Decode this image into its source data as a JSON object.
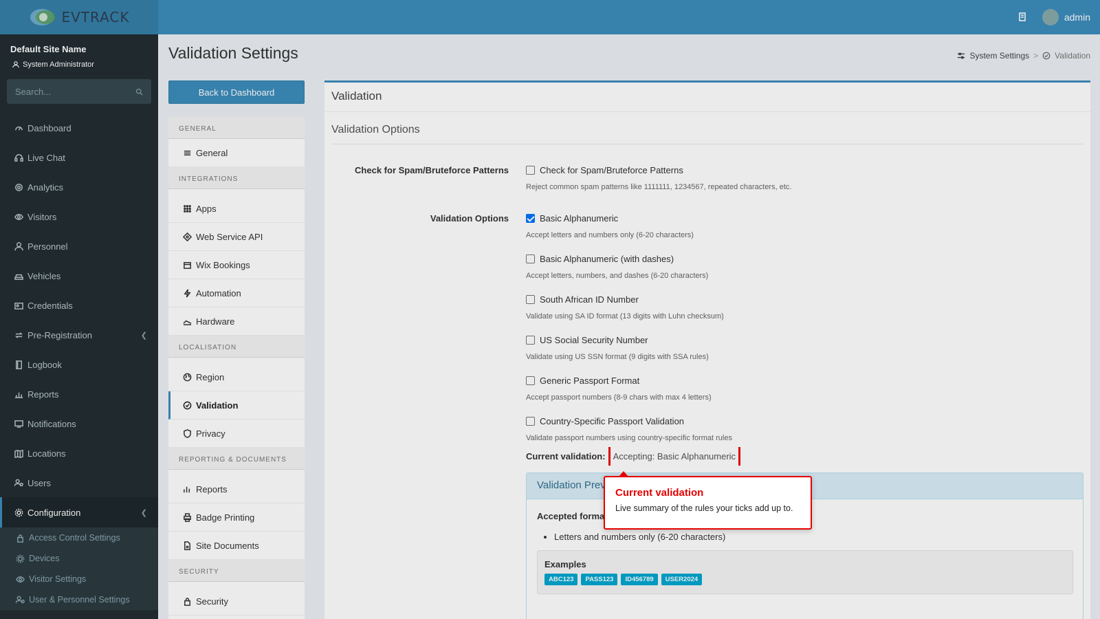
{
  "header": {
    "logo_text": "EVTRACK",
    "user_name": "admin",
    "icons": [
      "building-icon",
      "avatar"
    ]
  },
  "sidebar": {
    "site_name": "Default Site Name",
    "role": "System Administrator",
    "search_placeholder": "Search...",
    "items": [
      {
        "label": "Dashboard",
        "icon": "dashboard-icon"
      },
      {
        "label": "Live Chat",
        "icon": "headset-icon"
      },
      {
        "label": "Analytics",
        "icon": "target-icon"
      },
      {
        "label": "Visitors",
        "icon": "eye-icon"
      },
      {
        "label": "Personnel",
        "icon": "user-tie-icon"
      },
      {
        "label": "Vehicles",
        "icon": "car-icon"
      },
      {
        "label": "Credentials",
        "icon": "id-card-icon"
      },
      {
        "label": "Pre-Registration",
        "icon": "exchange-icon"
      },
      {
        "label": "Logbook",
        "icon": "book-icon"
      },
      {
        "label": "Reports",
        "icon": "chart-icon"
      },
      {
        "label": "Notifications",
        "icon": "bell-icon"
      },
      {
        "label": "Locations",
        "icon": "map-icon"
      },
      {
        "label": "Users",
        "icon": "users-icon"
      },
      {
        "label": "Configuration",
        "icon": "gear-icon"
      }
    ],
    "sub_items": [
      {
        "label": "Access Control Settings",
        "icon": "lock-icon"
      },
      {
        "label": "Devices",
        "icon": "chip-icon"
      },
      {
        "label": "Visitor Settings",
        "icon": "eye-icon"
      },
      {
        "label": "User & Personnel Settings",
        "icon": "users-icon"
      }
    ]
  },
  "page": {
    "title": "Validation Settings",
    "breadcrumb": [
      "System Settings",
      ">",
      "Validation"
    ],
    "back_button": "Back to Dashboard"
  },
  "settings_nav": {
    "sections": [
      {
        "header": "GENERAL",
        "items": [
          "General"
        ]
      },
      {
        "header": "INTEGRATIONS",
        "items": [
          "Apps",
          "Web Service API",
          "Wix Bookings",
          "Automation",
          "Hardware"
        ]
      },
      {
        "header": "LOCALISATION",
        "items": [
          "Region",
          "Validation",
          "Privacy"
        ]
      },
      {
        "header": "REPORTING & DOCUMENTS",
        "items": [
          "Reports",
          "Badge Printing",
          "Site Documents"
        ]
      },
      {
        "header": "SECURITY",
        "items": [
          "Security"
        ]
      }
    ],
    "active": "Validation"
  },
  "panel": {
    "title": "Validation",
    "section_title": "Validation Options",
    "spam_label": "Check for Spam/Bruteforce Patterns",
    "spam_checkbox": {
      "label": "Check for Spam/Bruteforce Patterns",
      "help": "Reject common spam patterns like 1111111, 1234567, repeated characters, etc.",
      "checked": false
    },
    "options_label": "Validation Options",
    "options": [
      {
        "label": "Basic Alphanumeric",
        "help": "Accept letters and numbers only (6-20 characters)",
        "checked": true
      },
      {
        "label": "Basic Alphanumeric (with dashes)",
        "help": "Accept letters, numbers, and dashes (6-20 characters)",
        "checked": false
      },
      {
        "label": "South African ID Number",
        "help": "Validate using SA ID format (13 digits with Luhn checksum)",
        "checked": false
      },
      {
        "label": "US Social Security Number",
        "help": "Validate using US SSN format (9 digits with SSA rules)",
        "checked": false
      },
      {
        "label": "Generic Passport Format",
        "help": "Accept passport numbers (8-9 chars with max 4 letters)",
        "checked": false
      },
      {
        "label": "Country-Specific Passport Validation",
        "help": "Validate passport numbers using country-specific format rules",
        "checked": false
      }
    ],
    "current_label": "Current validation:",
    "current_value": "Accepting: Basic Alphanumeric",
    "preview": {
      "title": "Validation Preview",
      "accepted_label": "Accepted formats:",
      "accepted_items": [
        "Letters and numbers only (6-20 characters)"
      ],
      "examples_title": "Examples",
      "examples": [
        "ABC123",
        "PASS123",
        "ID456789",
        "USER2024"
      ]
    }
  },
  "tooltip": {
    "title": "Current validation",
    "body": "Live summary of the rules your ticks add up to."
  },
  "colors": {
    "brand": "#3c8dbc",
    "sidebar": "#222d32",
    "highlight": "#e60000",
    "badge": "#00a7d0"
  }
}
